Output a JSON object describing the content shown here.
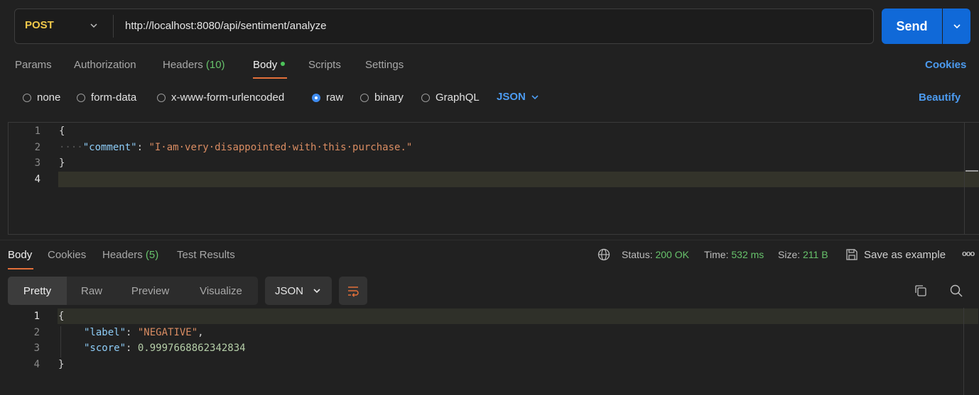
{
  "request": {
    "method": "POST",
    "url": "http://localhost:8080/api/sentiment/analyze",
    "send_label": "Send"
  },
  "request_tabs": {
    "params": "Params",
    "authorization": "Authorization",
    "headers": "Headers",
    "headers_count": "(10)",
    "body": "Body",
    "scripts": "Scripts",
    "settings": "Settings",
    "cookies": "Cookies"
  },
  "body_types": {
    "none": "none",
    "form_data": "form-data",
    "urlencoded": "x-www-form-urlencoded",
    "raw": "raw",
    "binary": "binary",
    "graphql": "GraphQL",
    "format": "JSON",
    "beautify": "Beautify",
    "selected": "raw"
  },
  "request_body": {
    "line_numbers": [
      "1",
      "2",
      "3",
      "4"
    ],
    "open_brace": "{",
    "indent": "····",
    "key": "\"comment\"",
    "colon": ": ",
    "value": "\"I·am·very·disappointed·with·this·purchase.\"",
    "close_brace": "}"
  },
  "response_tabs": {
    "body": "Body",
    "cookies": "Cookies",
    "headers": "Headers",
    "headers_count": "(5)",
    "test_results": "Test Results"
  },
  "response_meta": {
    "status_label": "Status:",
    "status_value": "200 OK",
    "time_label": "Time:",
    "time_value": "532 ms",
    "size_label": "Size:",
    "size_value": "211 B",
    "save_example": "Save as example",
    "more": "ooo"
  },
  "view_modes": {
    "pretty": "Pretty",
    "raw": "Raw",
    "preview": "Preview",
    "visualize": "Visualize",
    "format": "JSON"
  },
  "response_body": {
    "line_numbers": [
      "1",
      "2",
      "3",
      "4"
    ],
    "open_brace": "{",
    "label_key": "\"label\"",
    "label_value": "\"NEGATIVE\"",
    "score_key": "\"score\"",
    "score_value": "0.9997668862342834",
    "close_brace": "}"
  },
  "colors": {
    "accent": "#e3703a",
    "primary": "#1069d8",
    "link": "#4c9bf0",
    "success": "#67c26b",
    "method": "#f0c84a"
  }
}
